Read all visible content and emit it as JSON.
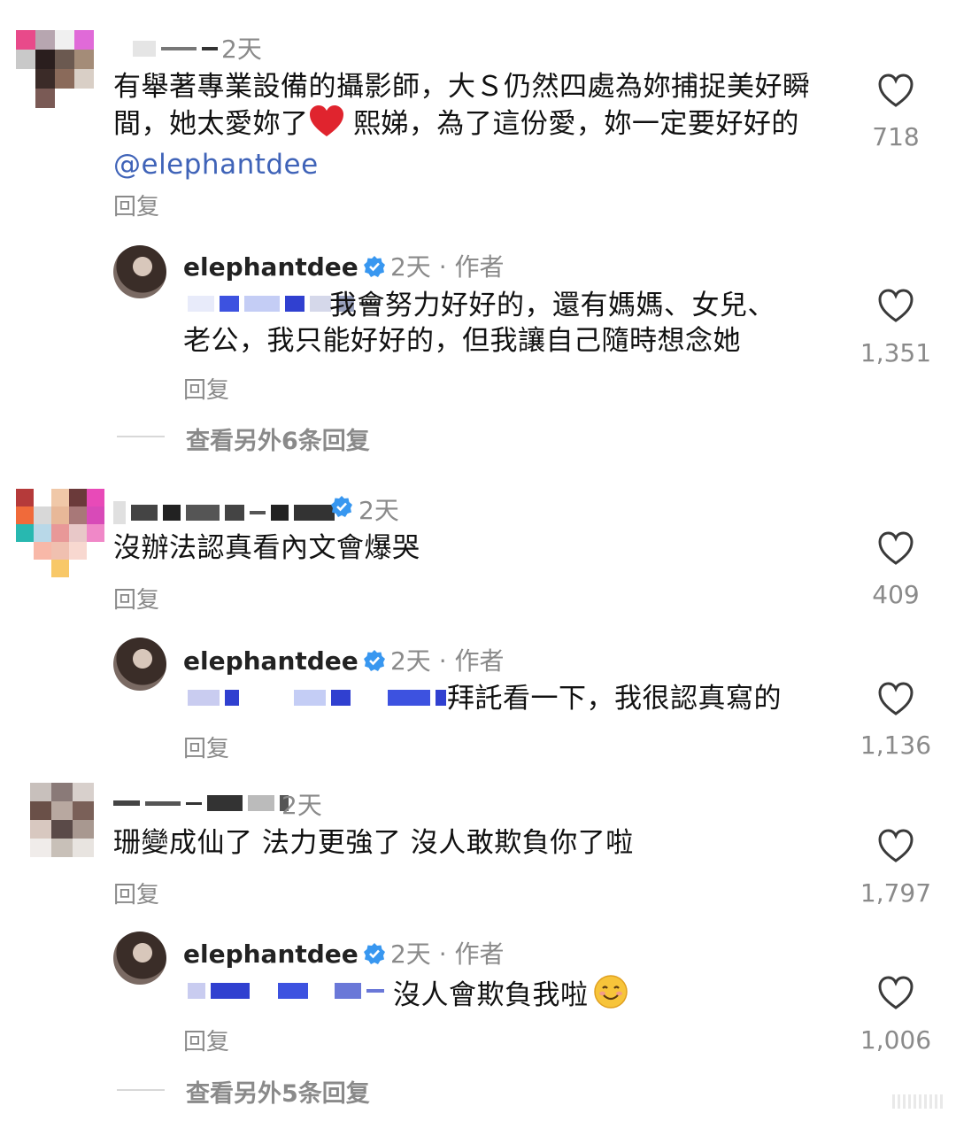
{
  "comments": [
    {
      "timestamp": "2天",
      "text": "有舉著專業設備的攝影師，大Ｓ仍然四處為妳捕捉美好瞬間，她太愛妳了",
      "text_after_emoji": " 熙娣，為了這份愛，妳一定要好好的 ",
      "mention": "@elephantdee",
      "likes": "718",
      "reply_label": "回复",
      "reply": {
        "username": "elephantdee",
        "meta": "2天 · 作者",
        "text": "我會努力好好的，還有媽媽、女兒、老公，我只能好好的，但我讓自己隨時想念她",
        "likes": "1,351",
        "reply_label": "回复"
      },
      "view_more": "查看另外6条回复"
    },
    {
      "timestamp": "2天",
      "text": "沒辦法認真看內文會爆哭",
      "likes": "409",
      "reply_label": "回复",
      "reply": {
        "username": "elephantdee",
        "meta": "2天 · 作者",
        "text": "拜託看一下，我很認真寫的",
        "likes": "1,136",
        "reply_label": "回复"
      }
    },
    {
      "timestamp": "2天",
      "text": "珊變成仙了 法力更強了 沒人敢欺負你了啦",
      "likes": "1,797",
      "reply_label": "回复",
      "reply": {
        "username": "elephantdee",
        "meta": "2天 · 作者",
        "text": "沒人會欺負我啦",
        "likes": "1,006",
        "reply_label": "回复"
      },
      "view_more": "查看另外5条回复"
    }
  ],
  "icons": {
    "heart": "heart-outline-icon",
    "verified": "verified-badge-icon",
    "red_heart": "red-heart-emoji",
    "smile": "smiling-face-emoji"
  },
  "colors": {
    "text": "#111111",
    "secondary": "#8a8a8a",
    "mention": "#3f63b8",
    "verified": "#3897f0",
    "red_heart": "#e0242e"
  }
}
